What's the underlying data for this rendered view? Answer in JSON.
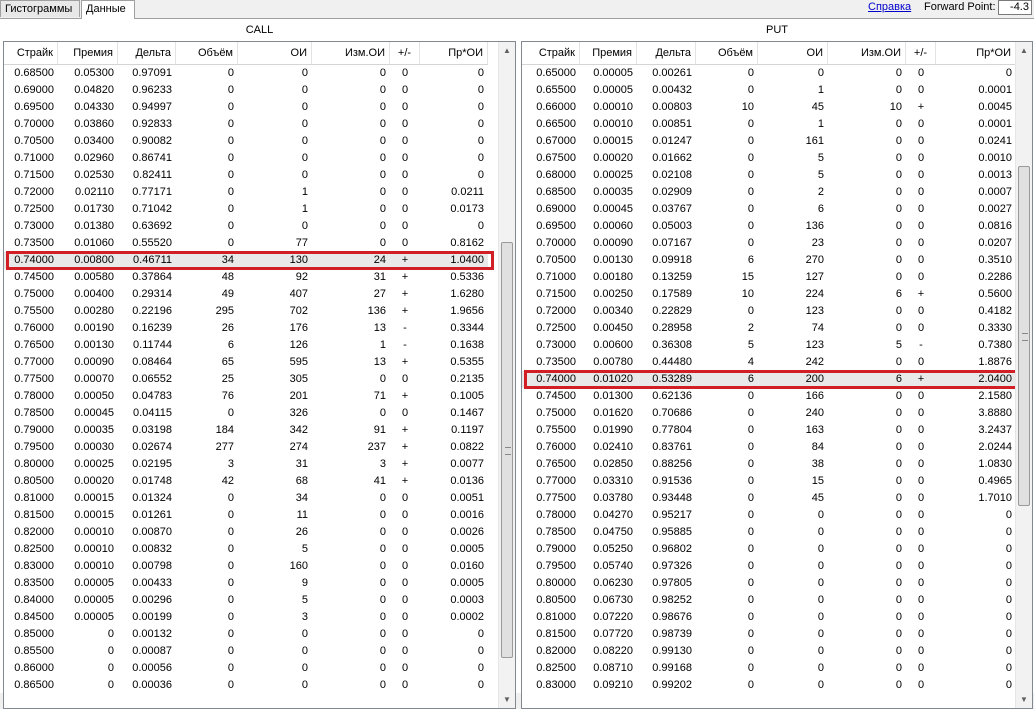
{
  "tabs": [
    {
      "label": "Гистограммы"
    },
    {
      "label": "Данные"
    }
  ],
  "help_label": "Справка",
  "forward_point": {
    "label": "Forward Point:",
    "value": "-4.3"
  },
  "call": {
    "title": "CALL",
    "headers": [
      "Страйк",
      "Премия",
      "Дельта",
      "Объём",
      "ОИ",
      "Изм.ОИ",
      "+/-",
      "Пр*ОИ"
    ],
    "selected_strike": "0.74000",
    "rows": [
      [
        "0.68500",
        "0.05300",
        "0.97091",
        "0",
        "0",
        "0",
        "0",
        "0"
      ],
      [
        "0.69000",
        "0.04820",
        "0.96233",
        "0",
        "0",
        "0",
        "0",
        "0"
      ],
      [
        "0.69500",
        "0.04330",
        "0.94997",
        "0",
        "0",
        "0",
        "0",
        "0"
      ],
      [
        "0.70000",
        "0.03860",
        "0.92833",
        "0",
        "0",
        "0",
        "0",
        "0"
      ],
      [
        "0.70500",
        "0.03400",
        "0.90082",
        "0",
        "0",
        "0",
        "0",
        "0"
      ],
      [
        "0.71000",
        "0.02960",
        "0.86741",
        "0",
        "0",
        "0",
        "0",
        "0"
      ],
      [
        "0.71500",
        "0.02530",
        "0.82411",
        "0",
        "0",
        "0",
        "0",
        "0"
      ],
      [
        "0.72000",
        "0.02110",
        "0.77171",
        "0",
        "1",
        "0",
        "0",
        "0.0211"
      ],
      [
        "0.72500",
        "0.01730",
        "0.71042",
        "0",
        "1",
        "0",
        "0",
        "0.0173"
      ],
      [
        "0.73000",
        "0.01380",
        "0.63692",
        "0",
        "0",
        "0",
        "0",
        "0"
      ],
      [
        "0.73500",
        "0.01060",
        "0.55520",
        "0",
        "77",
        "0",
        "0",
        "0.8162"
      ],
      [
        "0.74000",
        "0.00800",
        "0.46711",
        "34",
        "130",
        "24",
        "+",
        "1.0400"
      ],
      [
        "0.74500",
        "0.00580",
        "0.37864",
        "48",
        "92",
        "31",
        "+",
        "0.5336"
      ],
      [
        "0.75000",
        "0.00400",
        "0.29314",
        "49",
        "407",
        "27",
        "+",
        "1.6280"
      ],
      [
        "0.75500",
        "0.00280",
        "0.22196",
        "295",
        "702",
        "136",
        "+",
        "1.9656"
      ],
      [
        "0.76000",
        "0.00190",
        "0.16239",
        "26",
        "176",
        "13",
        "-",
        "0.3344"
      ],
      [
        "0.76500",
        "0.00130",
        "0.11744",
        "6",
        "126",
        "1",
        "-",
        "0.1638"
      ],
      [
        "0.77000",
        "0.00090",
        "0.08464",
        "65",
        "595",
        "13",
        "+",
        "0.5355"
      ],
      [
        "0.77500",
        "0.00070",
        "0.06552",
        "25",
        "305",
        "0",
        "0",
        "0.2135"
      ],
      [
        "0.78000",
        "0.00050",
        "0.04783",
        "76",
        "201",
        "71",
        "+",
        "0.1005"
      ],
      [
        "0.78500",
        "0.00045",
        "0.04115",
        "0",
        "326",
        "0",
        "0",
        "0.1467"
      ],
      [
        "0.79000",
        "0.00035",
        "0.03198",
        "184",
        "342",
        "91",
        "+",
        "0.1197"
      ],
      [
        "0.79500",
        "0.00030",
        "0.02674",
        "277",
        "274",
        "237",
        "+",
        "0.0822"
      ],
      [
        "0.80000",
        "0.00025",
        "0.02195",
        "3",
        "31",
        "3",
        "+",
        "0.0077"
      ],
      [
        "0.80500",
        "0.00020",
        "0.01748",
        "42",
        "68",
        "41",
        "+",
        "0.0136"
      ],
      [
        "0.81000",
        "0.00015",
        "0.01324",
        "0",
        "34",
        "0",
        "0",
        "0.0051"
      ],
      [
        "0.81500",
        "0.00015",
        "0.01261",
        "0",
        "11",
        "0",
        "0",
        "0.0016"
      ],
      [
        "0.82000",
        "0.00010",
        "0.00870",
        "0",
        "26",
        "0",
        "0",
        "0.0026"
      ],
      [
        "0.82500",
        "0.00010",
        "0.00832",
        "0",
        "5",
        "0",
        "0",
        "0.0005"
      ],
      [
        "0.83000",
        "0.00010",
        "0.00798",
        "0",
        "160",
        "0",
        "0",
        "0.0160"
      ],
      [
        "0.83500",
        "0.00005",
        "0.00433",
        "0",
        "9",
        "0",
        "0",
        "0.0005"
      ],
      [
        "0.84000",
        "0.00005",
        "0.00296",
        "0",
        "5",
        "0",
        "0",
        "0.0003"
      ],
      [
        "0.84500",
        "0.00005",
        "0.00199",
        "0",
        "3",
        "0",
        "0",
        "0.0002"
      ],
      [
        "0.85000",
        "0",
        "0.00132",
        "0",
        "0",
        "0",
        "0",
        "0"
      ],
      [
        "0.85500",
        "0",
        "0.00087",
        "0",
        "0",
        "0",
        "0",
        "0"
      ],
      [
        "0.86000",
        "0",
        "0.00056",
        "0",
        "0",
        "0",
        "0",
        "0"
      ],
      [
        "0.86500",
        "0",
        "0.00036",
        "0",
        "0",
        "0",
        "0",
        "0"
      ]
    ]
  },
  "put": {
    "title": "PUT",
    "headers": [
      "Страйк",
      "Премия",
      "Дельта",
      "Объём",
      "ОИ",
      "Изм.ОИ",
      "+/-",
      "Пр*ОИ"
    ],
    "selected_strike": "0.74000",
    "rows": [
      [
        "0.65000",
        "0.00005",
        "0.00261",
        "0",
        "0",
        "0",
        "0",
        "0"
      ],
      [
        "0.65500",
        "0.00005",
        "0.00432",
        "0",
        "1",
        "0",
        "0",
        "0.0001"
      ],
      [
        "0.66000",
        "0.00010",
        "0.00803",
        "10",
        "45",
        "10",
        "+",
        "0.0045"
      ],
      [
        "0.66500",
        "0.00010",
        "0.00851",
        "0",
        "1",
        "0",
        "0",
        "0.0001"
      ],
      [
        "0.67000",
        "0.00015",
        "0.01247",
        "0",
        "161",
        "0",
        "0",
        "0.0241"
      ],
      [
        "0.67500",
        "0.00020",
        "0.01662",
        "0",
        "5",
        "0",
        "0",
        "0.0010"
      ],
      [
        "0.68000",
        "0.00025",
        "0.02108",
        "0",
        "5",
        "0",
        "0",
        "0.0013"
      ],
      [
        "0.68500",
        "0.00035",
        "0.02909",
        "0",
        "2",
        "0",
        "0",
        "0.0007"
      ],
      [
        "0.69000",
        "0.00045",
        "0.03767",
        "0",
        "6",
        "0",
        "0",
        "0.0027"
      ],
      [
        "0.69500",
        "0.00060",
        "0.05003",
        "0",
        "136",
        "0",
        "0",
        "0.0816"
      ],
      [
        "0.70000",
        "0.00090",
        "0.07167",
        "0",
        "23",
        "0",
        "0",
        "0.0207"
      ],
      [
        "0.70500",
        "0.00130",
        "0.09918",
        "6",
        "270",
        "0",
        "0",
        "0.3510"
      ],
      [
        "0.71000",
        "0.00180",
        "0.13259",
        "15",
        "127",
        "0",
        "0",
        "0.2286"
      ],
      [
        "0.71500",
        "0.00250",
        "0.17589",
        "10",
        "224",
        "6",
        "+",
        "0.5600"
      ],
      [
        "0.72000",
        "0.00340",
        "0.22829",
        "0",
        "123",
        "0",
        "0",
        "0.4182"
      ],
      [
        "0.72500",
        "0.00450",
        "0.28958",
        "2",
        "74",
        "0",
        "0",
        "0.3330"
      ],
      [
        "0.73000",
        "0.00600",
        "0.36308",
        "5",
        "123",
        "5",
        "-",
        "0.7380"
      ],
      [
        "0.73500",
        "0.00780",
        "0.44480",
        "4",
        "242",
        "0",
        "0",
        "1.8876"
      ],
      [
        "0.74000",
        "0.01020",
        "0.53289",
        "6",
        "200",
        "6",
        "+",
        "2.0400"
      ],
      [
        "0.74500",
        "0.01300",
        "0.62136",
        "0",
        "166",
        "0",
        "0",
        "2.1580"
      ],
      [
        "0.75000",
        "0.01620",
        "0.70686",
        "0",
        "240",
        "0",
        "0",
        "3.8880"
      ],
      [
        "0.75500",
        "0.01990",
        "0.77804",
        "0",
        "163",
        "0",
        "0",
        "3.2437"
      ],
      [
        "0.76000",
        "0.02410",
        "0.83761",
        "0",
        "84",
        "0",
        "0",
        "2.0244"
      ],
      [
        "0.76500",
        "0.02850",
        "0.88256",
        "0",
        "38",
        "0",
        "0",
        "1.0830"
      ],
      [
        "0.77000",
        "0.03310",
        "0.91536",
        "0",
        "15",
        "0",
        "0",
        "0.4965"
      ],
      [
        "0.77500",
        "0.03780",
        "0.93448",
        "0",
        "45",
        "0",
        "0",
        "1.7010"
      ],
      [
        "0.78000",
        "0.04270",
        "0.95217",
        "0",
        "0",
        "0",
        "0",
        "0"
      ],
      [
        "0.78500",
        "0.04750",
        "0.95885",
        "0",
        "0",
        "0",
        "0",
        "0"
      ],
      [
        "0.79000",
        "0.05250",
        "0.96802",
        "0",
        "0",
        "0",
        "0",
        "0"
      ],
      [
        "0.79500",
        "0.05740",
        "0.97326",
        "0",
        "0",
        "0",
        "0",
        "0"
      ],
      [
        "0.80000",
        "0.06230",
        "0.97805",
        "0",
        "0",
        "0",
        "0",
        "0"
      ],
      [
        "0.80500",
        "0.06730",
        "0.98252",
        "0",
        "0",
        "0",
        "0",
        "0"
      ],
      [
        "0.81000",
        "0.07220",
        "0.98676",
        "0",
        "0",
        "0",
        "0",
        "0"
      ],
      [
        "0.81500",
        "0.07720",
        "0.98739",
        "0",
        "0",
        "0",
        "0",
        "0"
      ],
      [
        "0.82000",
        "0.08220",
        "0.99130",
        "0",
        "0",
        "0",
        "0",
        "0"
      ],
      [
        "0.82500",
        "0.08710",
        "0.99168",
        "0",
        "0",
        "0",
        "0",
        "0"
      ],
      [
        "0.83000",
        "0.09210",
        "0.99202",
        "0",
        "0",
        "0",
        "0",
        "0"
      ]
    ]
  },
  "colors": {
    "highlight": "#d21f26",
    "selected_row": "#e9e9e9",
    "link": "#0000cc"
  }
}
